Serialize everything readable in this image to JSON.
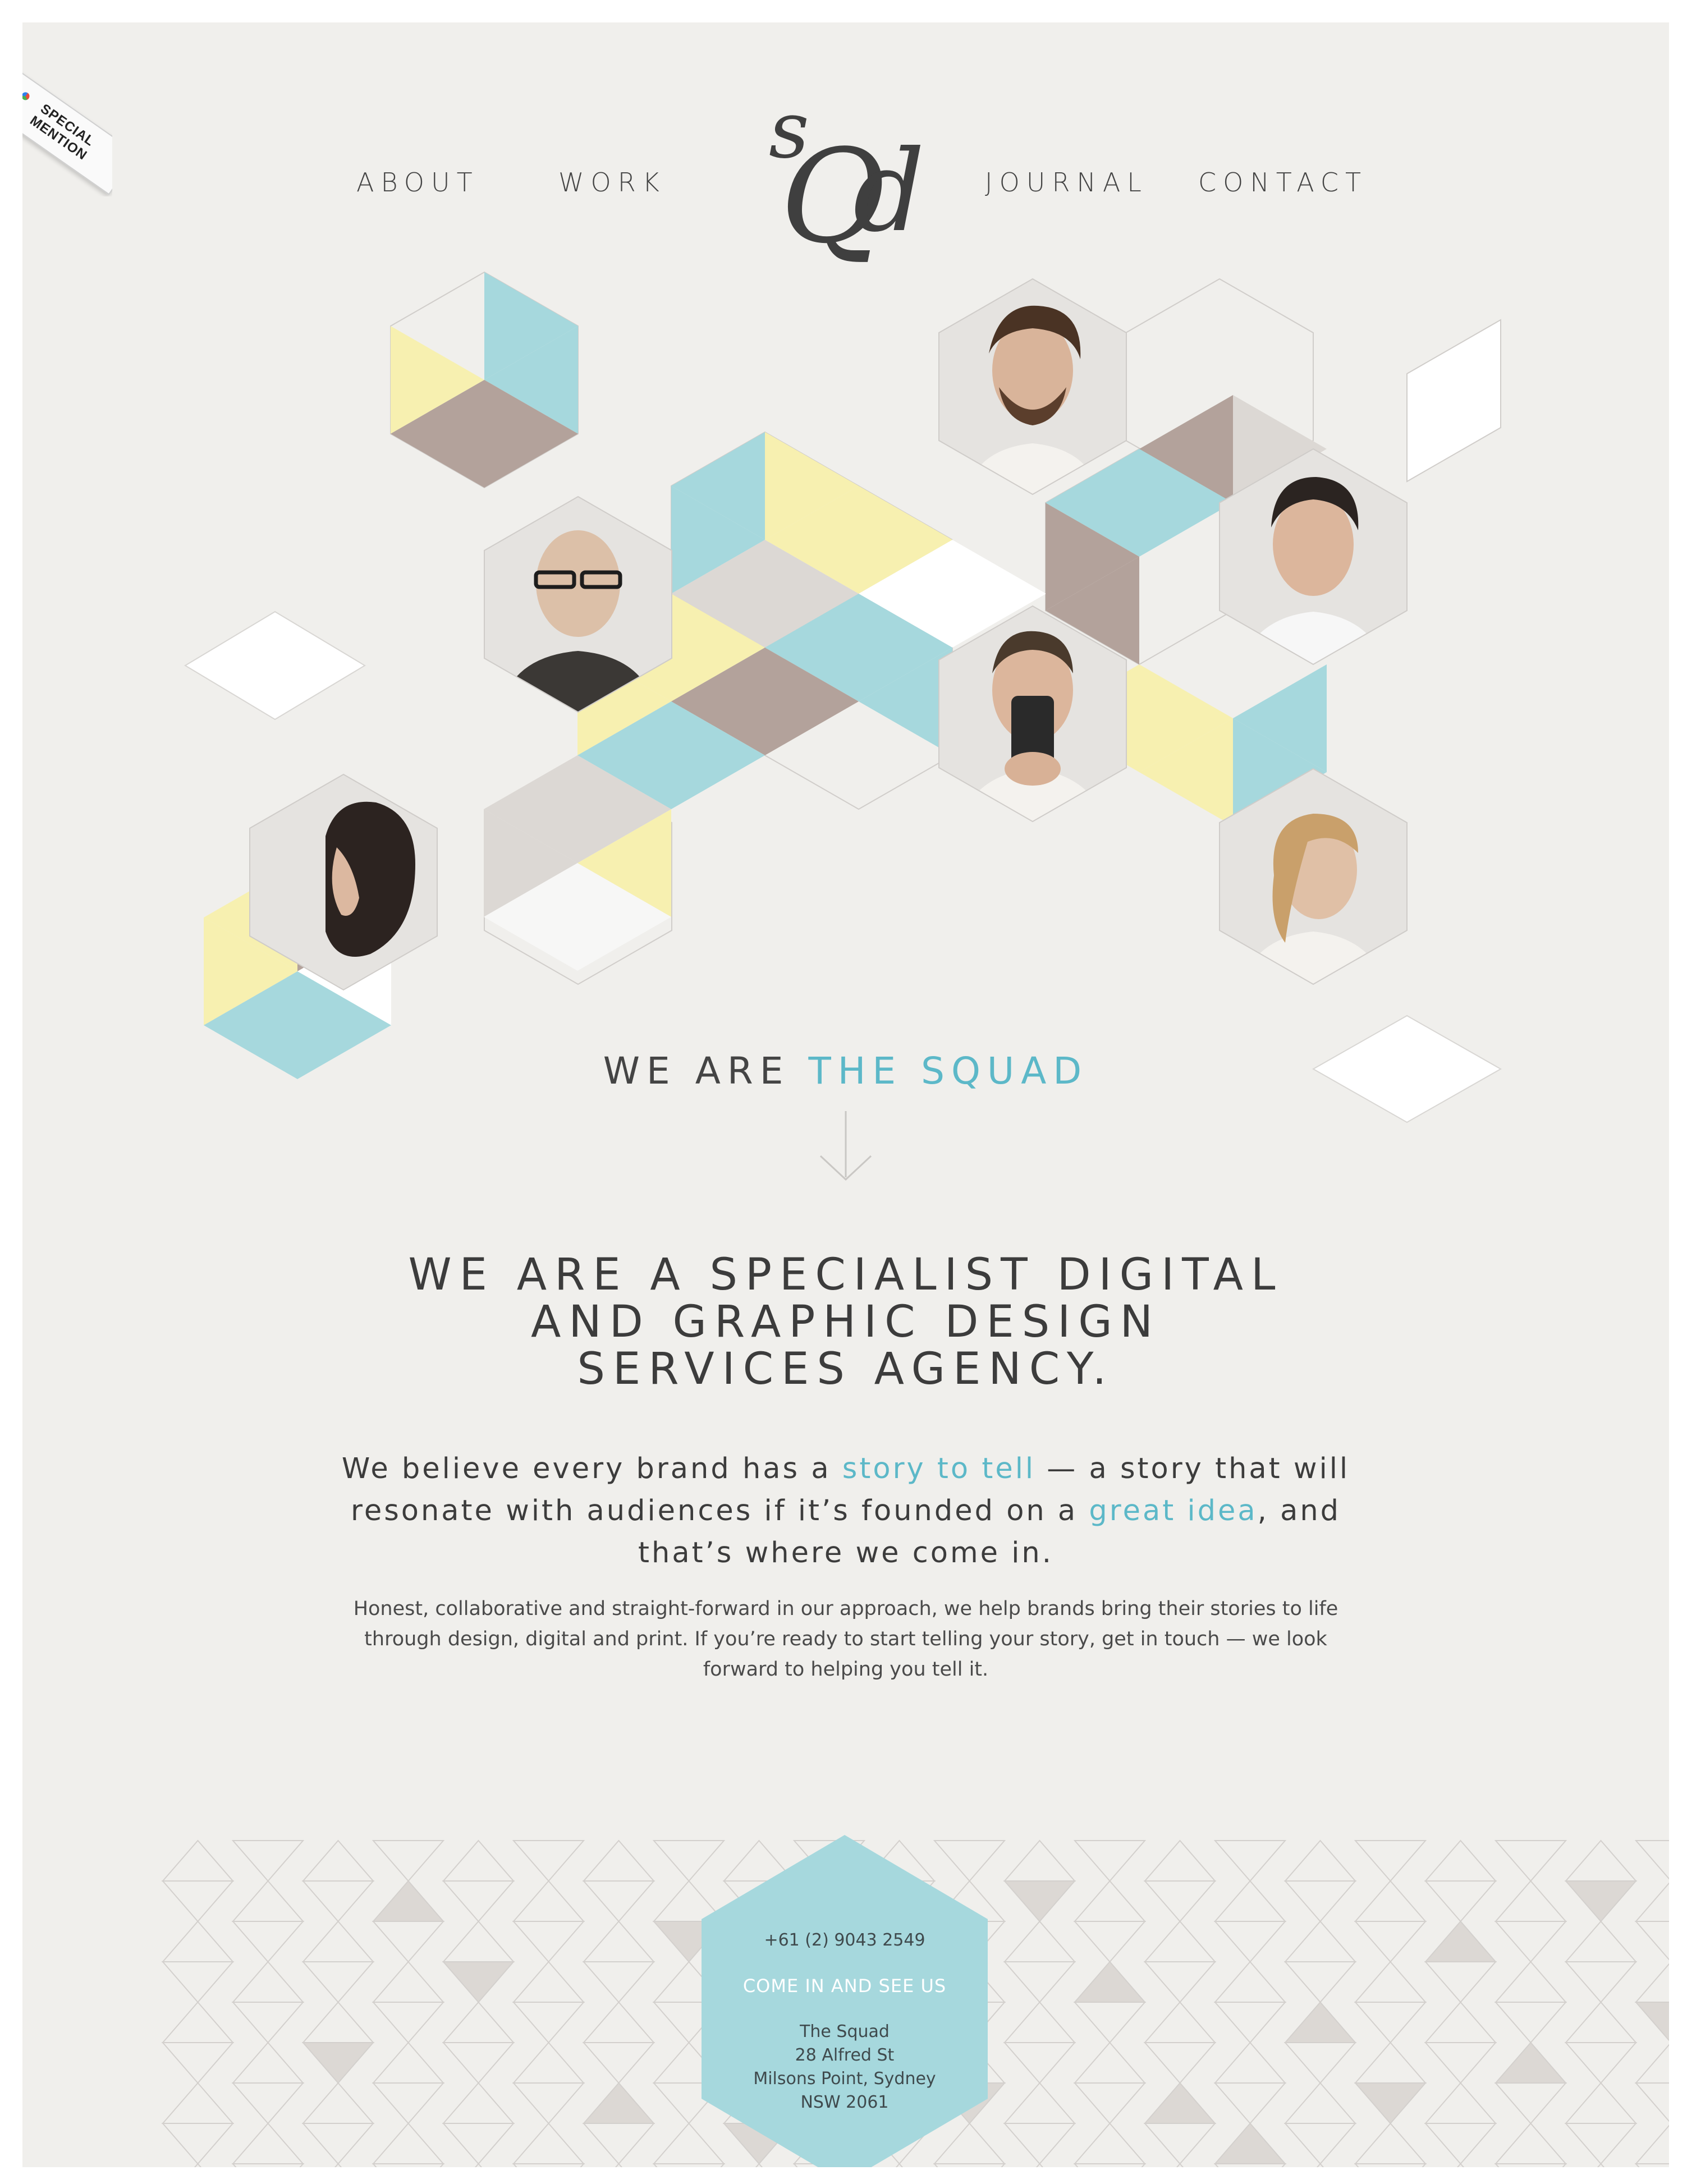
{
  "ribbon": {
    "line1": "SPECIAL",
    "line2": "MENTION"
  },
  "nav": {
    "about": "ABOUT",
    "work": "WORK",
    "journal": "JOURNAL",
    "contact": "CONTACT"
  },
  "logo": {
    "text": "SQd"
  },
  "tagline": {
    "prefix": "WE ARE ",
    "accent": "THE SQUAD"
  },
  "headline": {
    "line1": "WE ARE A SPECIALIST DIGITAL",
    "line2": "AND GRAPHIC DESIGN",
    "line3": "SERVICES AGENCY."
  },
  "lead": {
    "part1": "We believe every brand has a ",
    "link1": "story to tell",
    "part2": " — a story that will resonate with audiences if it’s founded on a ",
    "link2": "great idea",
    "part3": ", and that’s where we come in."
  },
  "body_copy": "Honest, collaborative and straight-forward in our approach, we help brands bring their stories to life through design, digital and print. If you’re ready to start telling your story, get in touch — we look forward to helping you tell it.",
  "contact": {
    "phone": "+61 (2) 9043 2549",
    "cta": "COME IN AND SEE US",
    "name": "The Squad",
    "street": "28 Alfred St",
    "suburb": "Milsons Point, Sydney",
    "postcode": "NSW 2061"
  },
  "colors": {
    "background": "#f0efec",
    "accent": "#5cb8c8",
    "teal_tile": "#a6d8dd",
    "yellow_tile": "#f7f0b0",
    "brown_tile": "#b3a29b",
    "grey_tile": "#dcd8d4",
    "text": "#3a3a3a"
  }
}
